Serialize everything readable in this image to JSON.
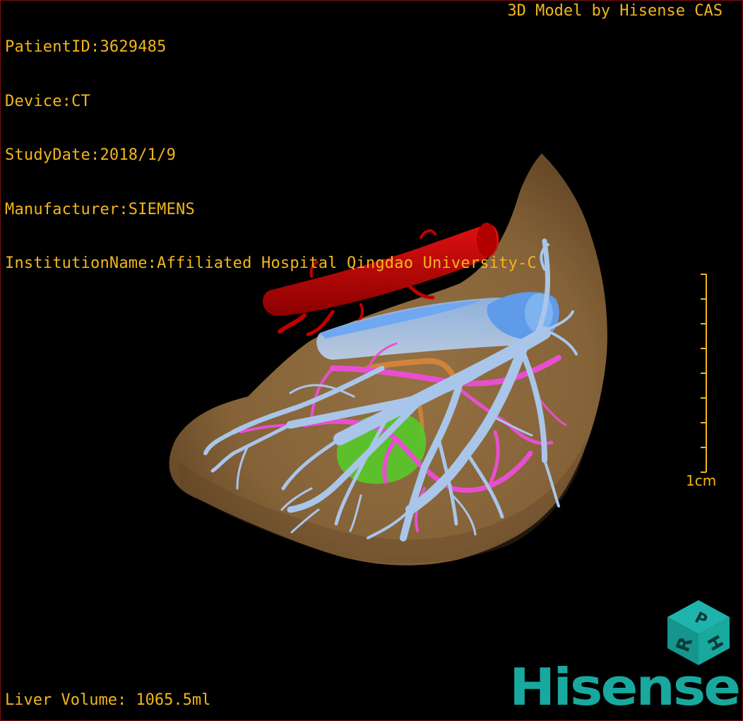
{
  "info": {
    "patient_id": "PatientID:3629485",
    "device": "Device:CT",
    "study_date": "StudyDate:2018/1/9",
    "manufacturer": "Manufacturer:SIEMENS",
    "institution": "InstitutionName:Affiliated Hospital Qingdao University-C"
  },
  "model_credit": "3D Model by Hisense CAS",
  "liver_volume": "Liver Volume: 1065.5ml",
  "scale": {
    "label": "1cm",
    "ticks": 8
  },
  "orientation_cube": {
    "face_front": "R",
    "face_top": "P",
    "face_side": "H"
  },
  "brand": "Hisense",
  "colors": {
    "overlay_text": "#f2b61c",
    "liver": "#8c6a3e",
    "portal_vein": "#a9c6ea",
    "hepatic_artery": "#e84fd0",
    "inferior_vena_cava": "#6fa8f0",
    "aorta": "#c00000",
    "gallbladder": "#58c82a",
    "bile_duct": "#e08a3a",
    "brand": "#19a89e"
  }
}
